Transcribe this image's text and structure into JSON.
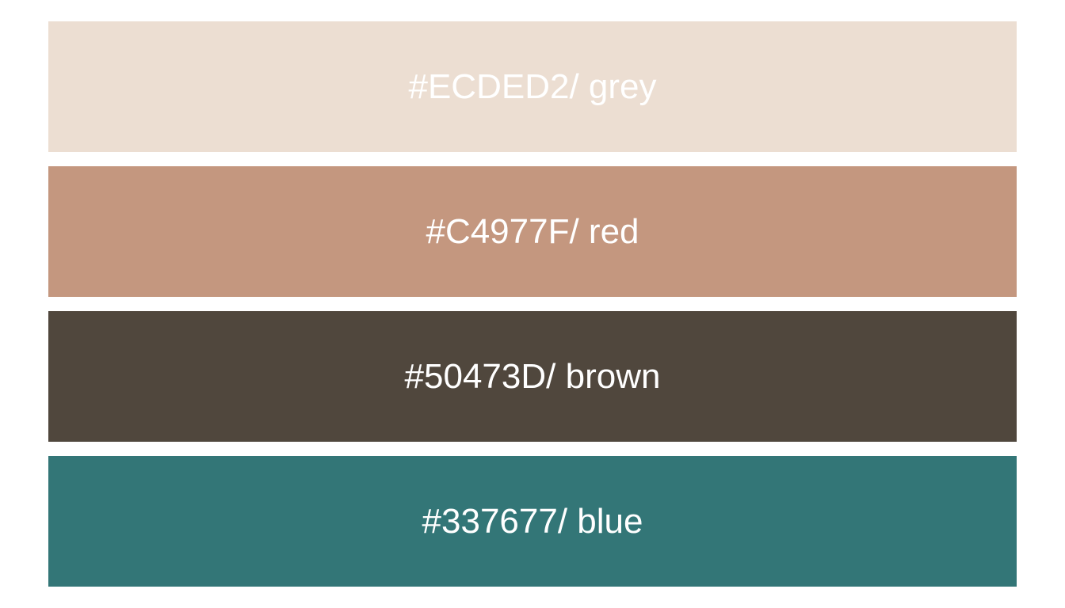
{
  "swatches": [
    {
      "label": "#ECDED2/ grey",
      "color": "#ECDED2"
    },
    {
      "label": "#C4977F/ red",
      "color": "#C4977F"
    },
    {
      "label": "#50473D/ brown",
      "color": "#50473D"
    },
    {
      "label": "#337677/ blue",
      "color": "#337677"
    }
  ],
  "text_color": "#FFFFFF",
  "background_color": "#FFFFFF"
}
